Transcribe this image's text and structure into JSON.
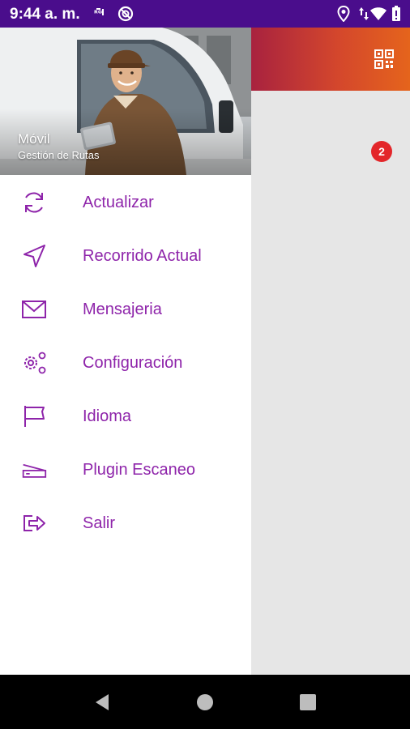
{
  "status_bar": {
    "time": "9:44 a. m.",
    "left_icons": [
      "nfc-signal-icon",
      "data-saver-icon"
    ],
    "right_icons": [
      "location-icon",
      "data-transfer-icon",
      "wifi-icon",
      "battery-icon"
    ]
  },
  "app_bar": {
    "gradient_colors": [
      "#a8223f",
      "#e5641c"
    ],
    "qr_icon": "qr-code-icon",
    "badge_count": "2"
  },
  "drawer": {
    "header": {
      "title": "Móvil",
      "subtitle": "Gestión de Rutas"
    },
    "items": [
      {
        "label": "Actualizar",
        "icon": "refresh-icon"
      },
      {
        "label": "Recorrido Actual",
        "icon": "navigation-icon"
      },
      {
        "label": "Mensajeria",
        "icon": "mail-icon"
      },
      {
        "label": "Configuración",
        "icon": "gears-icon"
      },
      {
        "label": "Idioma",
        "icon": "flag-icon"
      },
      {
        "label": "Plugin Escaneo",
        "icon": "scanner-icon"
      },
      {
        "label": "Salir",
        "icon": "logout-icon"
      }
    ],
    "accent_color": "#8e24aa"
  },
  "nav_bar": {
    "buttons": [
      "back-icon",
      "home-icon",
      "recents-icon"
    ]
  }
}
